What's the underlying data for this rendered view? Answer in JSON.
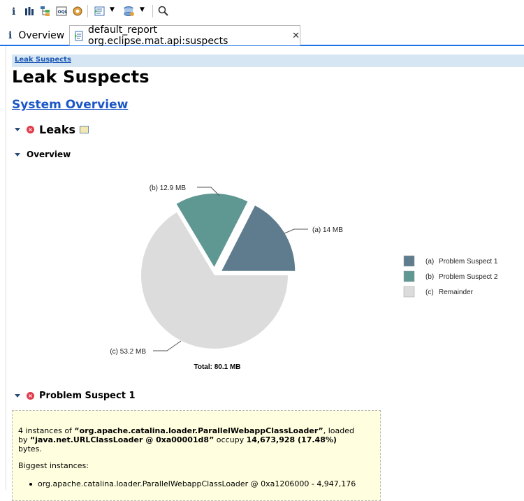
{
  "toolbar": {
    "icons": [
      "info-icon",
      "histogram-icon",
      "dominator-tree-icon",
      "oql-icon",
      "thread-overview-icon",
      "query-browser-icon",
      "heap-dump-overview-icon",
      "search-icon"
    ]
  },
  "tabs": [
    {
      "label": "Overview",
      "icon": "info-icon"
    },
    {
      "label": "default_report org.eclipse.mat.api:suspects",
      "icon": "report-icon",
      "close": "✕"
    }
  ],
  "breadcrumb": "Leak Suspects",
  "page_title": "Leak Suspects",
  "system_overview_link": "System Overview",
  "sections": {
    "leaks": "Leaks",
    "overview": "Overview",
    "problem_suspect_1": "Problem Suspect 1"
  },
  "colors": {
    "suspect_1": "#5f7c8e",
    "suspect_2": "#5f9792",
    "remainder": "#dcdcdc",
    "link": "#1a56c6",
    "breadcrumb_bg": "#d6e6f2",
    "suspect_box_bg": "#ffffe0"
  },
  "chart_data": {
    "type": "pie",
    "total_label": "Total: 80.1 MB",
    "slices": [
      {
        "key": "a",
        "label": "(a)  14 MB",
        "value": 14,
        "legend": "Problem Suspect 1"
      },
      {
        "key": "b",
        "label": "(b)  12.9 MB",
        "value": 12.9,
        "legend": "Problem Suspect 2"
      },
      {
        "key": "c",
        "label": "(c)  53.2 MB",
        "value": 53.2,
        "legend": "Remainder"
      }
    ],
    "legend_keys": [
      "(a)",
      "(b)",
      "(c)"
    ],
    "legend_placement": "right"
  },
  "suspect1": {
    "line1_pre": "4 instances of ",
    "class_name": "“org.apache.catalina.loader.ParallelWebappClassLoader”",
    "line1_post": ", loaded",
    "by_pre": "by ",
    "loader": "“java.net.URLClassLoader @ 0xa00001d8”",
    "occupy": " occupy ",
    "size": "14,673,928 (17.48%)",
    "bytes": "bytes.",
    "biggest_label": "Biggest instances:",
    "biggest_item": "org.apache.catalina.loader.ParallelWebappClassLoader @ 0xa1206000 - 4,947,176"
  }
}
